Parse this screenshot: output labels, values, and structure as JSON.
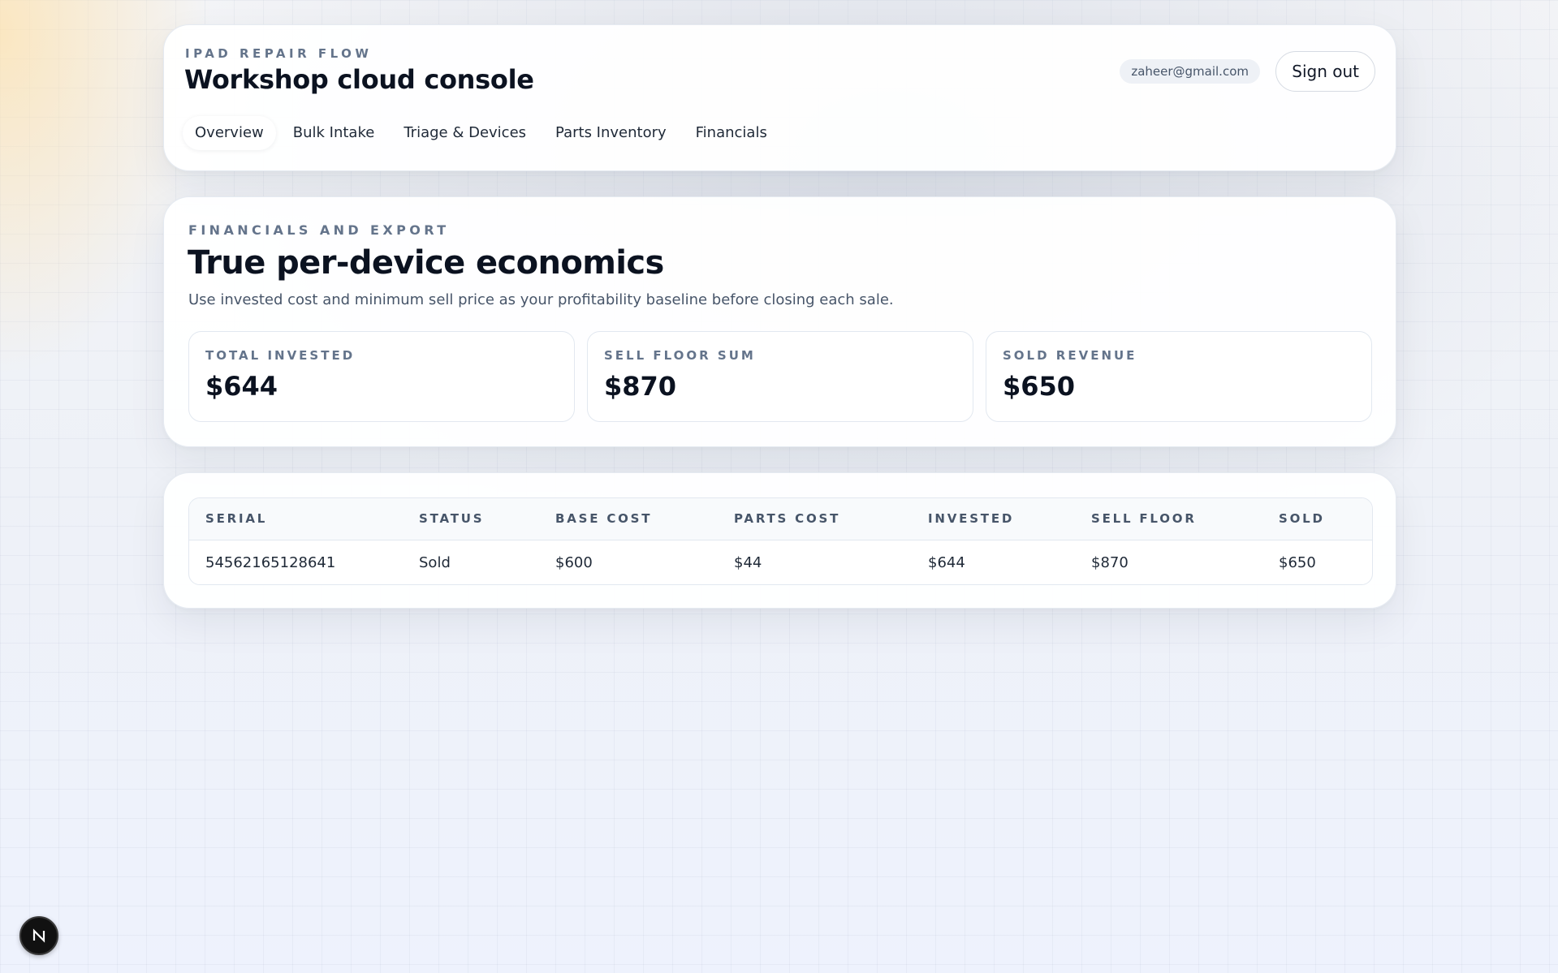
{
  "header": {
    "eyebrow": "IPAD REPAIR FLOW",
    "title": "Workshop cloud console",
    "user_email": "zaheer@gmail.com",
    "sign_out_label": "Sign out",
    "tabs": [
      {
        "label": "Overview",
        "active": true
      },
      {
        "label": "Bulk Intake",
        "active": false
      },
      {
        "label": "Triage & Devices",
        "active": false
      },
      {
        "label": "Parts Inventory",
        "active": false
      },
      {
        "label": "Financials",
        "active": false
      }
    ]
  },
  "financials": {
    "eyebrow": "FINANCIALS AND EXPORT",
    "title": "True per-device economics",
    "description": "Use invested cost and minimum sell price as your profitability baseline before closing each sale.",
    "stats": [
      {
        "label": "TOTAL INVESTED",
        "value": "$644"
      },
      {
        "label": "SELL FLOOR SUM",
        "value": "$870"
      },
      {
        "label": "SOLD REVENUE",
        "value": "$650"
      }
    ]
  },
  "devices_table": {
    "columns": [
      "SERIAL",
      "STATUS",
      "BASE COST",
      "PARTS COST",
      "INVESTED",
      "SELL FLOOR",
      "SOLD"
    ],
    "rows": [
      [
        "54562165128641",
        "Sold",
        "$600",
        "$44",
        "$644",
        "$870",
        "$650"
      ]
    ]
  },
  "badge": {
    "icon": "n-logo-icon",
    "background": "#111111",
    "foreground": "#ffffff"
  }
}
